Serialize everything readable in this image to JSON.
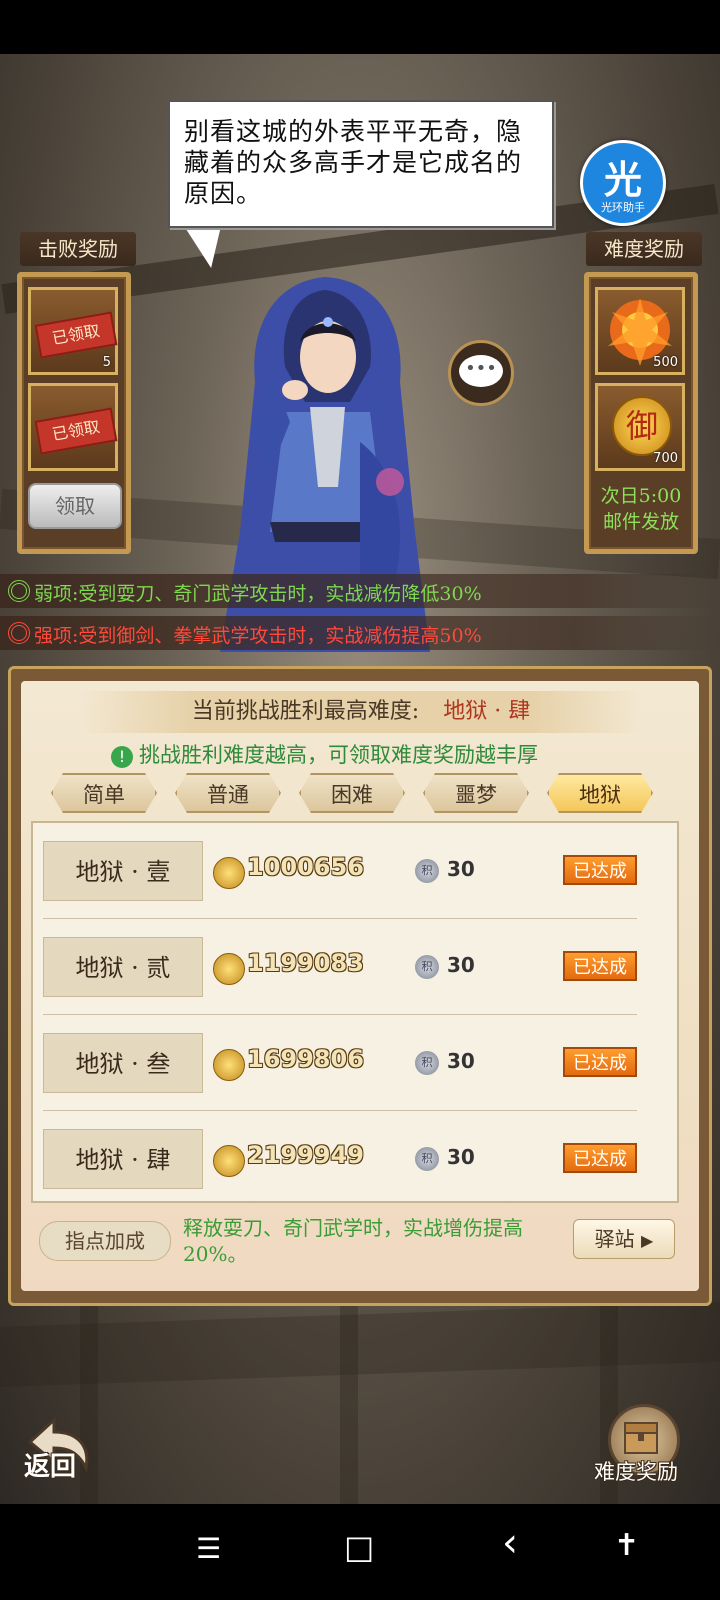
{
  "dialogue": "别看这城的外表平平无奇，隐藏着的众多高手才是它成名的原因。",
  "helper": {
    "char": "光",
    "label": "光环助手"
  },
  "left_panel": {
    "title": "击败奖励",
    "items": [
      {
        "stamp": "已领取",
        "count": "5"
      },
      {
        "stamp": "已领取",
        "count": ""
      }
    ],
    "collect_label": "领取"
  },
  "right_panel": {
    "title": "难度奖励",
    "items": [
      {
        "count": "500",
        "icon": "flame-lotus-icon"
      },
      {
        "count": "700",
        "icon": "royal-seal-icon",
        "glyph": "御"
      }
    ],
    "note_line1": "次日5:00",
    "note_line2": "邮件发放"
  },
  "attributes": {
    "weak": "弱项:受到耍刀、奇门武学攻击时，实战减伤降低30%",
    "strong": "强项:受到御剑、拳掌武学攻击时，实战减伤提高50%",
    "weak_color": "#7fd850",
    "strong_color": "#ff4a3a"
  },
  "main": {
    "header_label": "当前挑战胜利最高难度:",
    "header_value": "地狱 · 肆",
    "tip": "挑战胜利难度越高，可领取难度奖励越丰厚",
    "tabs": [
      "简单",
      "普通",
      "困难",
      "噩梦",
      "地狱"
    ],
    "active_tab": "地狱",
    "rows": [
      {
        "name": "地狱 · 壹",
        "score": "1000656",
        "points": "30",
        "status": "已达成"
      },
      {
        "name": "地狱 · 贰",
        "score": "1199083",
        "points": "30",
        "status": "已达成"
      },
      {
        "name": "地狱 · 叁",
        "score": "1699806",
        "points": "30",
        "status": "已达成"
      },
      {
        "name": "地狱 · 肆",
        "score": "2199949",
        "points": "30",
        "status": "已达成"
      }
    ],
    "points_glyph": "积",
    "bonus_label": "指点加成",
    "bonus_text": "释放耍刀、奇门武学时，实战增伤提高20%。",
    "station_label": "驿站"
  },
  "bottom": {
    "back_label": "返回",
    "reward_label": "难度奖励"
  },
  "navbar": {
    "menu": "☰",
    "home": "□",
    "back": "‹",
    "accessibility": "✝"
  }
}
